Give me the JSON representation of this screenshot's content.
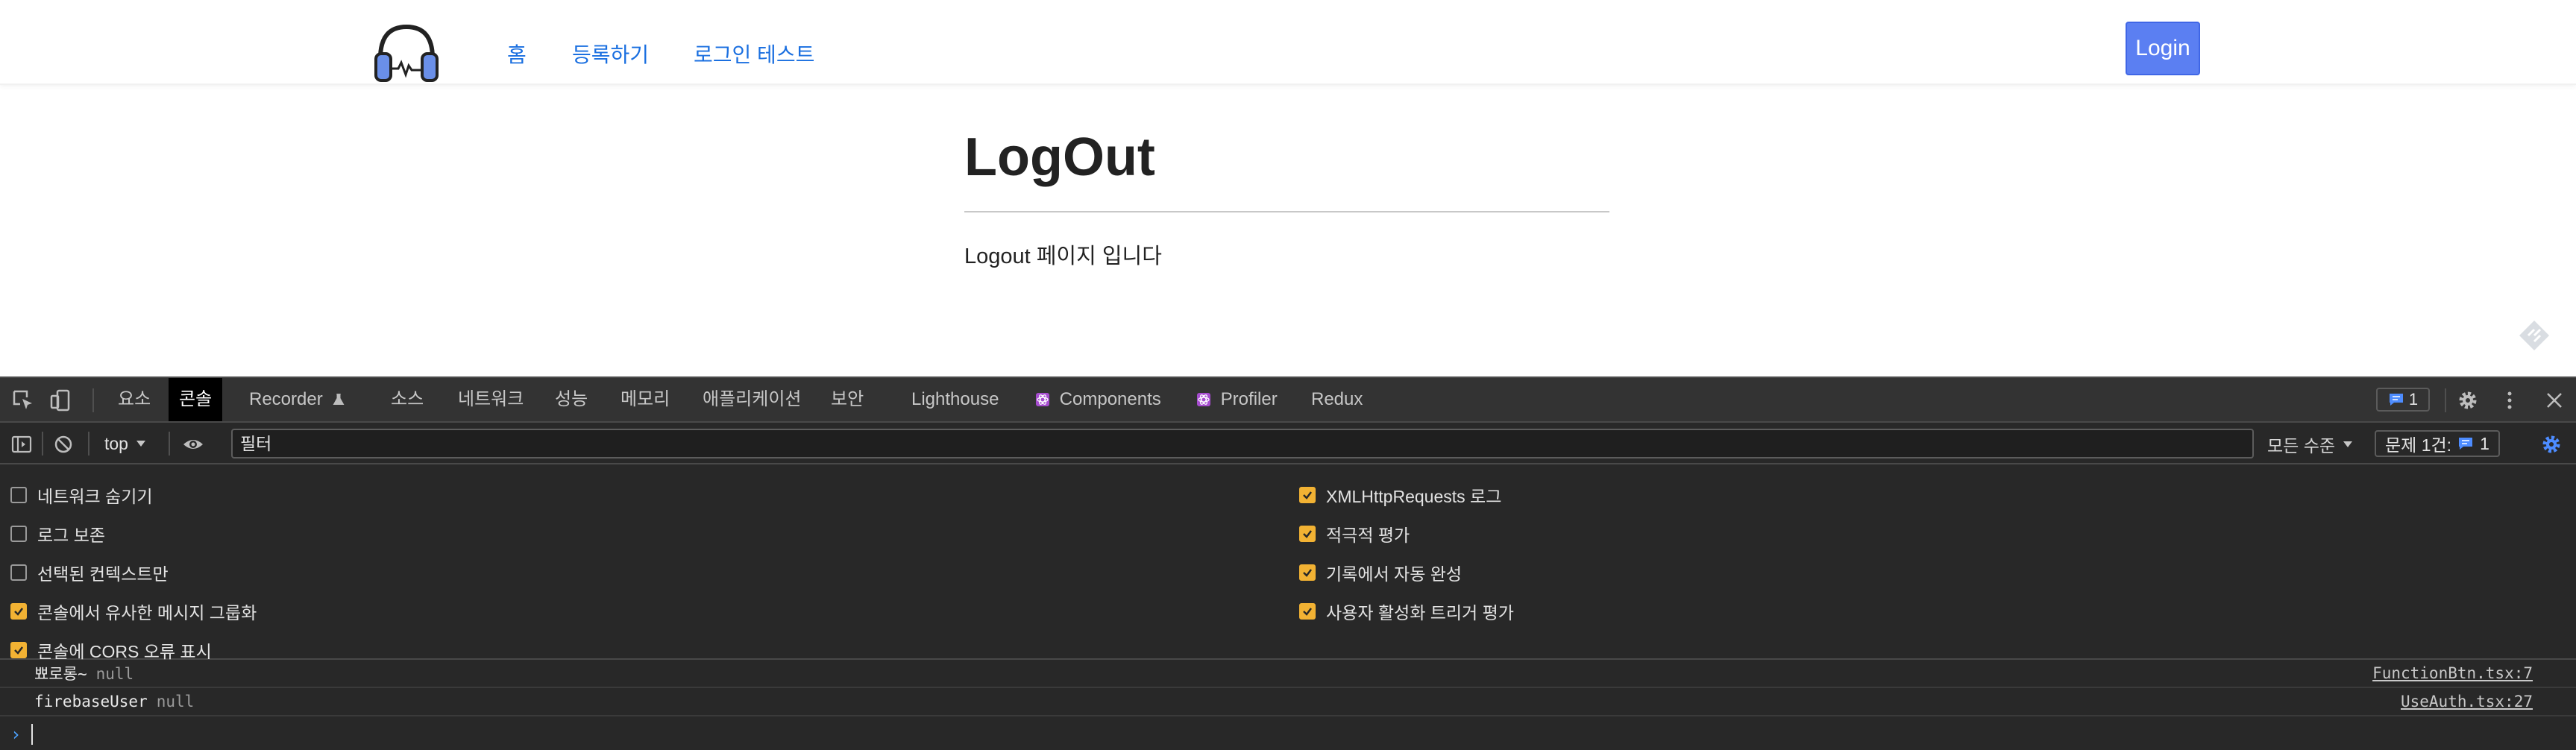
{
  "page": {
    "nav": [
      {
        "label": "홈"
      },
      {
        "label": "등록하기"
      },
      {
        "label": "로그인 테스트"
      }
    ],
    "login_label": "Login",
    "title": "LogOut",
    "description": "Logout 페이지 입니다"
  },
  "devtools": {
    "tabs": [
      {
        "label": "요소",
        "active": false
      },
      {
        "label": "콘솔",
        "active": true
      },
      {
        "label": "Recorder",
        "active": false
      },
      {
        "label": "소스",
        "active": false
      },
      {
        "label": "네트워크",
        "active": false
      },
      {
        "label": "성능",
        "active": false
      },
      {
        "label": "메모리",
        "active": false
      },
      {
        "label": "애플리케이션",
        "active": false
      },
      {
        "label": "보안",
        "active": false
      },
      {
        "label": "Lighthouse",
        "active": false
      },
      {
        "label": "Components",
        "active": false
      },
      {
        "label": "Profiler",
        "active": false
      },
      {
        "label": "Redux",
        "active": false
      }
    ],
    "message_count": "1",
    "context": "top",
    "filter_placeholder": "필터",
    "levels_label": "모든 수준",
    "issues_label": "문제 1건:",
    "issues_count": "1",
    "options_left": [
      {
        "label": "네트워크 숨기기",
        "checked": false
      },
      {
        "label": "로그 보존",
        "checked": false
      },
      {
        "label": "선택된 컨텍스트만",
        "checked": false
      },
      {
        "label": "콘솔에서 유사한 메시지 그룹화",
        "checked": true
      },
      {
        "label": "콘솔에 CORS 오류 표시",
        "checked": true
      }
    ],
    "options_right": [
      {
        "label": "XMLHttpRequests 로그",
        "checked": true
      },
      {
        "label": "적극적 평가",
        "checked": true
      },
      {
        "label": "기록에서 자동 완성",
        "checked": true
      },
      {
        "label": "사용자 활성화 트리거 평가",
        "checked": true
      }
    ],
    "logs": [
      {
        "label": "뾰로롱~",
        "value": "null",
        "source": "FunctionBtn.tsx:7"
      },
      {
        "label": "firebaseUser",
        "value": "null",
        "source": "UseAuth.tsx:27"
      }
    ],
    "colors": {
      "accent": "#f2b233",
      "link": "#1a6fe0",
      "login_btn": "#5b7ff2",
      "badge": "#4d8cff"
    },
    "icons": [
      "inspect-icon",
      "device-toggle-icon",
      "flask-icon",
      "react-icon",
      "message-icon",
      "gear-icon",
      "kebab-menu-icon",
      "close-icon",
      "sidebar-toggle-icon",
      "clear-console-icon",
      "eye-icon",
      "caret-down-icon"
    ]
  }
}
